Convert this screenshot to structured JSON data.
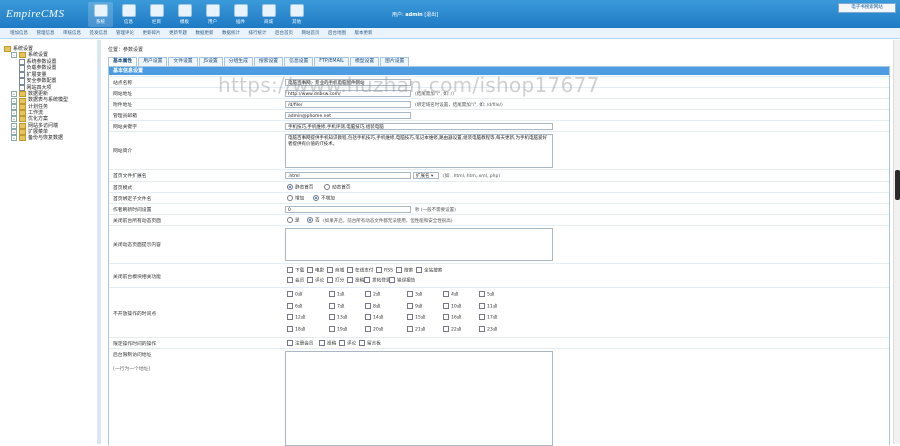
{
  "app": {
    "logo": "EmpireCMS"
  },
  "header": {
    "nav": [
      "系统",
      "信息",
      "栏目",
      "模板",
      "用户",
      "插件",
      "商城",
      "其他"
    ],
    "user_prefix": "用户:",
    "user_name": "admin",
    "logout": "[退出]",
    "top_right_button": "电子书搜索网站"
  },
  "submenu": [
    "增加信息",
    "管理信息",
    "审核信息",
    "签发信息",
    "管理评论",
    "更新碎片",
    "更新专题",
    "数据更新",
    "数据统计",
    "排行统计",
    "后台首页",
    "网站首页",
    "后台地图",
    "版本更新"
  ],
  "sidebar": {
    "items": [
      {
        "label": "系统设置",
        "level": 0,
        "kind": "root"
      },
      {
        "label": "系统设置",
        "level": 1,
        "kind": "folder-open"
      },
      {
        "label": "系统参数设置",
        "level": 2,
        "kind": "doc"
      },
      {
        "label": "负载参数设置",
        "level": 2,
        "kind": "doc"
      },
      {
        "label": "扩展变量",
        "level": 2,
        "kind": "doc"
      },
      {
        "label": "安全参数配置",
        "level": 2,
        "kind": "doc"
      },
      {
        "label": "网站四大项",
        "level": 2,
        "kind": "doc"
      },
      {
        "label": "数据更新",
        "level": 1,
        "kind": "folder"
      },
      {
        "label": "数据表与系统模型",
        "level": 1,
        "kind": "folder"
      },
      {
        "label": "计划任务",
        "level": 1,
        "kind": "folder"
      },
      {
        "label": "工作流",
        "level": 1,
        "kind": "folder"
      },
      {
        "label": "优化方案",
        "level": 1,
        "kind": "folder"
      },
      {
        "label": "网站多访问端",
        "level": 1,
        "kind": "folder"
      },
      {
        "label": "扩展菜单",
        "level": 1,
        "kind": "folder"
      },
      {
        "label": "备份与恢复数据",
        "level": 1,
        "kind": "folder"
      }
    ]
  },
  "main": {
    "breadcrumb": "位置：参数设置",
    "tabs": [
      "基本属性",
      "用户设置",
      "文件设置",
      "JS设置",
      "分组生成",
      "搜索设置",
      "信息设置",
      "FTP/EMAIL",
      "模型设置",
      "图片设置"
    ],
    "panel_title": "基本信息设置",
    "fields": {
      "site_name": {
        "label": "站点名称",
        "value": "电脑百事网 - 专业的手机电脑配件网站"
      },
      "site_url": {
        "label": "网站地址",
        "value": "http://www.dnbsw.com/",
        "hint": "(结尾需加\"/\", 如: /)"
      },
      "attach_url": {
        "label": "附件地址",
        "value": "/d/file/",
        "hint": "(绑定域名时设置，结尾需加\"/\", 如: /d/file/)"
      },
      "admin_email": {
        "label": "管理员邮箱",
        "value": "admin@phome.net"
      },
      "keywords": {
        "label": "网站关键字",
        "value": "手机技巧,手机维修,手机评测,电脑技巧,组装电脑"
      },
      "intro": {
        "label": "网站简介",
        "value": "电脑百事网提供手机知识教程,包括手机技巧,手机维修,电脑技巧,笔记本维修,路由器设置,组装电脑教程等,每天更新,为手机电脑爱好者提供有价值的IT技术。"
      },
      "index_ext": {
        "label": "首页文件扩展名",
        "value": ".html",
        "select": "扩展名",
        "hint": "(如: .html,.htm,.xml,.php)"
      },
      "index_mode": {
        "label": "首页模式",
        "opt1": "静态首页",
        "opt2": "动态首页"
      },
      "index_bind": {
        "label": "首页绑定子文件名",
        "opt1": "增加",
        "opt2": "不增加"
      },
      "op_interval": {
        "label": "作者刷新时间设置",
        "value": "0",
        "hint": "秒 (一般不需要设置)"
      },
      "close_site": {
        "label": "关闭前台所有动态页面",
        "opt1": "是",
        "opt2": "否",
        "hint": "(如果开启，前台所有动态文件都无法使用，但性能和安全性很高)"
      },
      "close_msg": {
        "label": "关闭动态页面提示内容"
      },
      "close_modules": {
        "label": "关闭前台模块相关功能",
        "row1": [
          "下载",
          "电影",
          "商城",
          "在线支付",
          "RSS",
          "搜索",
          "全站搜索"
        ],
        "row2": [
          "会员",
          "评论",
          "打分",
          "投稿",
          "发帖登录",
          "错误报告"
        ]
      },
      "hours": {
        "label": "不开放操作的时间点",
        "values": [
          "0点",
          "1点",
          "2点",
          "3点",
          "4点",
          "5点",
          "6点",
          "7点",
          "8点",
          "9点",
          "10点",
          "11点",
          "12点",
          "13点",
          "14点",
          "15点",
          "16点",
          "17点",
          "18点",
          "19点",
          "20点",
          "21点",
          "22点",
          "23点"
        ]
      },
      "time_ops": {
        "label": "限定操作时间的操作",
        "opts": [
          "注册会员",
          "投稿",
          "评论",
          "留言板"
        ]
      },
      "ip_list": {
        "label": "后台限制访问地址",
        "sub": "(一行为一个地址)"
      }
    }
  },
  "watermark": "https://www.huzhan.com/ishop17677",
  "colors": {
    "topbar": "#1f7ac4",
    "panel_head": "#4d9be0",
    "accent": "#2a6fb3"
  }
}
